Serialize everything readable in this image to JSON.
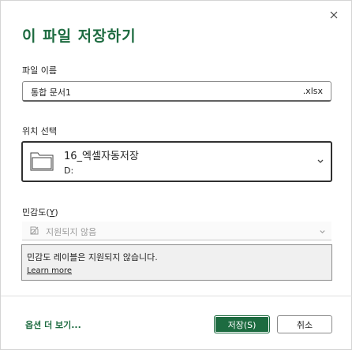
{
  "dialog": {
    "title": "이 파일 저장하기",
    "close_icon": "close-icon"
  },
  "filename": {
    "label": "파일 이름",
    "value": "통합 문서1",
    "extension": ".xlsx"
  },
  "location": {
    "label": "위치 선택",
    "folder_name": "16_엑셀자동저장",
    "path": "D:",
    "icon": "folder-icon"
  },
  "sensitivity": {
    "label": "민감도",
    "accelerator": "Y",
    "selected": "지원되지 않음",
    "icon": "sensitivity-label-icon",
    "info_text": "민감도 레이블은 지원되지 않습니다.",
    "learn_more": "Learn more"
  },
  "footer": {
    "more_options": "옵션 더 보기...",
    "save_label": "저장(S)",
    "cancel_label": "취소"
  },
  "colors": {
    "accent": "#1d6b40",
    "info_background": "#f0f0f0"
  }
}
